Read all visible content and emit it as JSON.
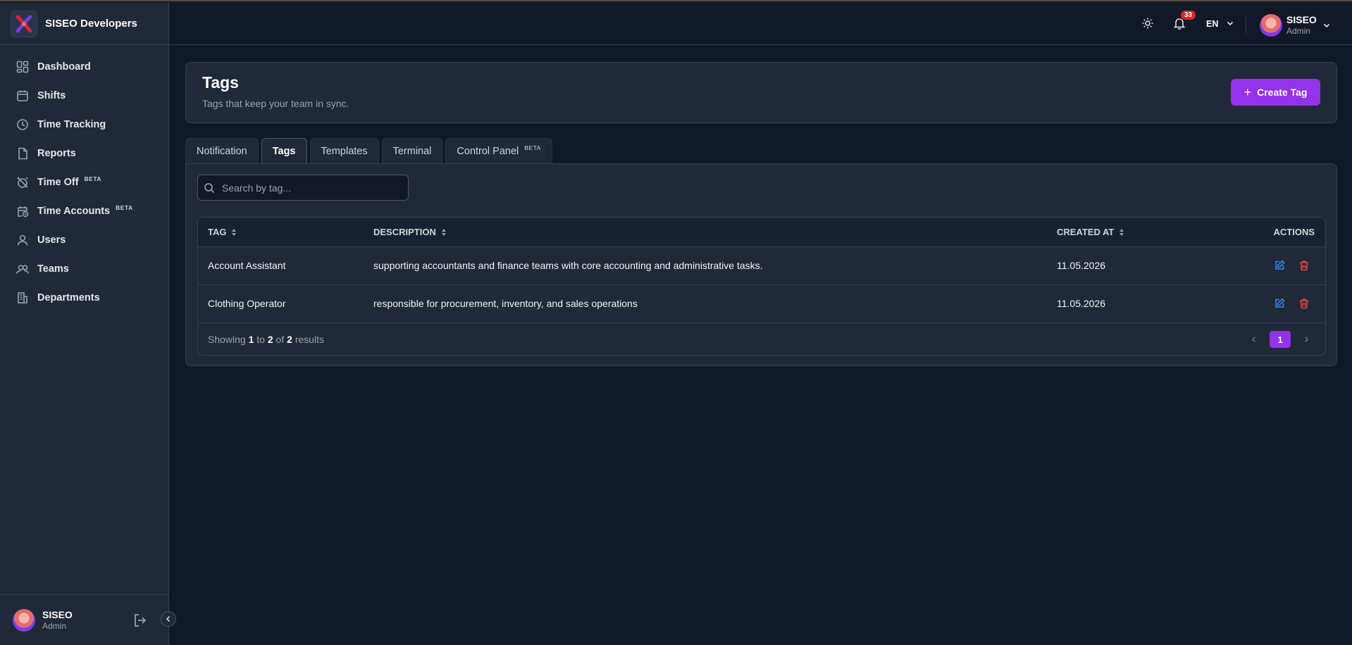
{
  "brand": {
    "name": "SISEO Developers"
  },
  "sidebar": {
    "items": [
      {
        "label": "Dashboard",
        "icon": "dashboard-icon"
      },
      {
        "label": "Shifts",
        "icon": "calendar-icon"
      },
      {
        "label": "Time Tracking",
        "icon": "clock-icon"
      },
      {
        "label": "Reports",
        "icon": "file-icon"
      },
      {
        "label": "Time Off",
        "icon": "alarm-off-icon",
        "badge": "BETA"
      },
      {
        "label": "Time Accounts",
        "icon": "calendar-clock-icon",
        "badge": "BETA"
      },
      {
        "label": "Users",
        "icon": "user-icon"
      },
      {
        "label": "Teams",
        "icon": "users-icon"
      },
      {
        "label": "Departments",
        "icon": "building-icon"
      }
    ],
    "footer": {
      "name": "SISEO",
      "role": "Admin"
    }
  },
  "topbar": {
    "notifications_count": "33",
    "language": "EN",
    "user": {
      "name": "SISEO",
      "role": "Admin"
    }
  },
  "header": {
    "title": "Tags",
    "subtitle": "Tags that keep your team in sync.",
    "create_label": "Create Tag"
  },
  "tabs": [
    {
      "label": "Notification"
    },
    {
      "label": "Tags",
      "active": true
    },
    {
      "label": "Templates"
    },
    {
      "label": "Terminal"
    },
    {
      "label": "Control Panel",
      "badge": "BETA"
    }
  ],
  "search": {
    "placeholder": "Search by tag..."
  },
  "table": {
    "headers": {
      "tag": "TAG",
      "description": "DESCRIPTION",
      "created": "CREATED AT",
      "actions": "ACTIONS"
    },
    "rows": [
      {
        "tag": "Account Assistant",
        "description": "supporting accountants and finance teams with core accounting and administrative tasks.",
        "created": "11.05.2026"
      },
      {
        "tag": "Clothing Operator",
        "description": "responsible for procurement, inventory, and sales operations",
        "created": "11.05.2026"
      }
    ],
    "footer": {
      "showing": "Showing",
      "from": "1",
      "to_word": "to",
      "to": "2",
      "of_word": "of",
      "total": "2",
      "results": "results"
    },
    "current_page": "1"
  },
  "colors": {
    "accent": "#9333ea",
    "edit": "#3b82f6",
    "delete": "#ef4444",
    "badge": "#dc2626"
  }
}
